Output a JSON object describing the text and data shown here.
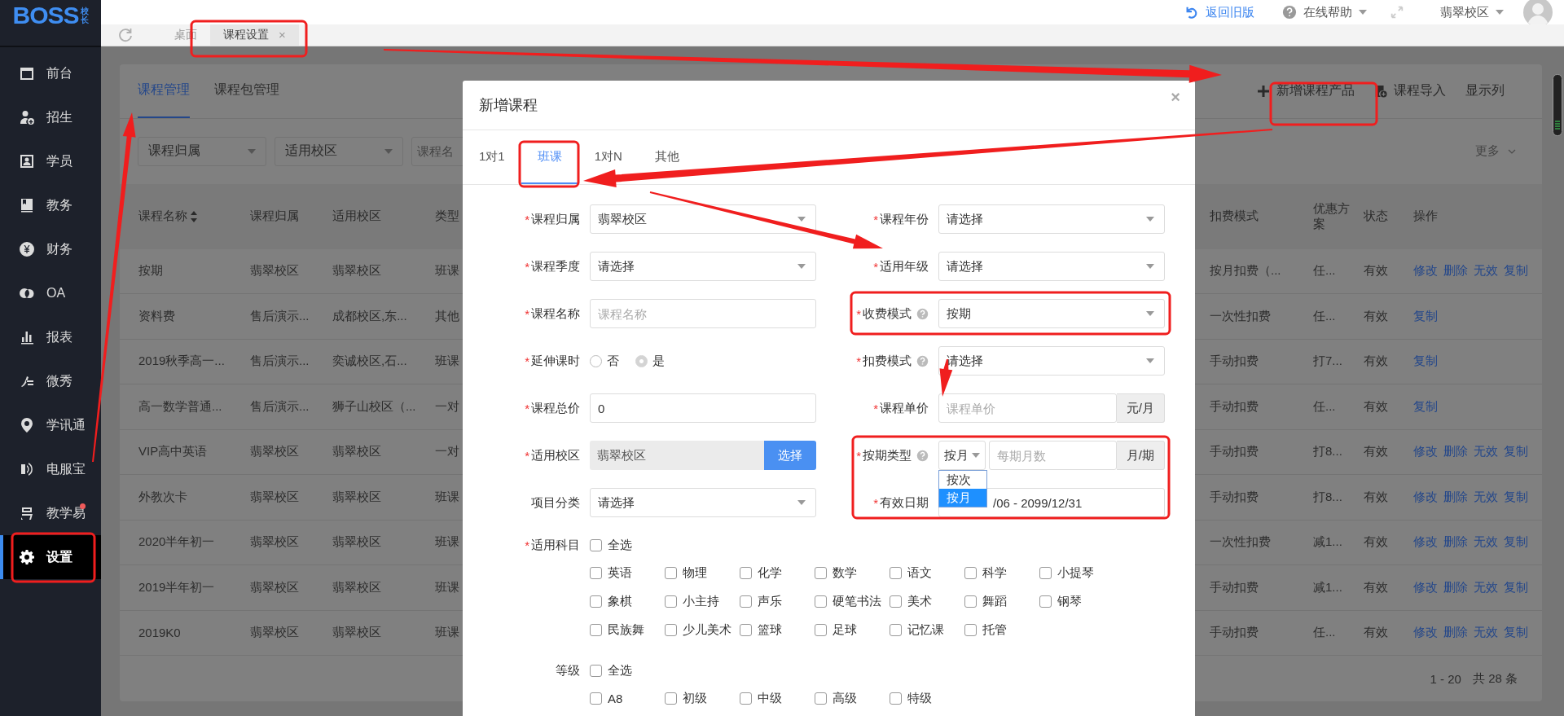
{
  "sidebar": {
    "logo": "BOSS",
    "logo_badge": "校长",
    "items": [
      {
        "label": "前台",
        "selected": false,
        "dot": false
      },
      {
        "label": "招生",
        "selected": false,
        "dot": false
      },
      {
        "label": "学员",
        "selected": false,
        "dot": false
      },
      {
        "label": "教务",
        "selected": false,
        "dot": false
      },
      {
        "label": "财务",
        "selected": false,
        "dot": false
      },
      {
        "label": "OA",
        "selected": false,
        "dot": false
      },
      {
        "label": "报表",
        "selected": false,
        "dot": false
      },
      {
        "label": "微秀",
        "selected": false,
        "dot": false
      },
      {
        "label": "学讯通",
        "selected": false,
        "dot": false
      },
      {
        "label": "电服宝",
        "selected": false,
        "dot": false
      },
      {
        "label": "教学易",
        "selected": false,
        "dot": true
      },
      {
        "label": "设置",
        "selected": true,
        "dot": false
      }
    ]
  },
  "topbar": {
    "back_link": "返回旧版",
    "help_menu": "在线帮助",
    "campus_menu": "翡翠校区"
  },
  "tabs": [
    {
      "label": "桌面",
      "selected": false
    },
    {
      "label": "课程设置",
      "selected": true,
      "close": "×"
    }
  ],
  "page": {
    "tabs": [
      {
        "label": "课程管理",
        "selected": true
      },
      {
        "label": "课程包管理",
        "selected": false
      }
    ],
    "actions": [
      "新增课程产品",
      "课程导入",
      "显示列"
    ],
    "filters": [
      {
        "kind": "select",
        "placeholder": "课程归属"
      },
      {
        "kind": "select",
        "placeholder": "适用校区"
      },
      {
        "kind": "input",
        "placeholder": "课程名"
      }
    ],
    "more": "更多"
  },
  "table": {
    "columns": [
      {
        "label": "课程名称",
        "sortable": true
      },
      {
        "label": "课程归属",
        "sortable": false
      },
      {
        "label": "适用校区",
        "sortable": false
      },
      {
        "label": "类型",
        "sortable": false
      },
      {
        "label": "扣费模式",
        "sortable": false
      },
      {
        "label": "优惠方案",
        "sortable": false
      },
      {
        "label": "状态",
        "sortable": false
      },
      {
        "label": "操作",
        "sortable": false
      }
    ],
    "rows": [
      {
        "cells": [
          "按期",
          "翡翠校区",
          "翡翠校区",
          "班课",
          "按月扣费（...",
          "任...",
          "有效"
        ],
        "actions": [
          "修改",
          "删除",
          "无效",
          "复制"
        ]
      },
      {
        "cells": [
          "资料费",
          "售后演示...",
          "成都校区,东...",
          "其他",
          "一次性扣费",
          "任...",
          "有效"
        ],
        "actions": [
          "复制"
        ]
      },
      {
        "cells": [
          "2019秋季高一...",
          "售后演示...",
          "奕诚校区,石...",
          "班课",
          "手动扣费",
          "打7...",
          "有效"
        ],
        "actions": [
          "复制"
        ]
      },
      {
        "cells": [
          "高一数学普通...",
          "售后演示...",
          "狮子山校区（...",
          "一对",
          "手动扣费",
          "任...",
          "有效"
        ],
        "actions": [
          "复制"
        ]
      },
      {
        "cells": [
          "VIP高中英语",
          "翡翠校区",
          "翡翠校区",
          "一对",
          "手动扣费",
          "打8...",
          "有效"
        ],
        "actions": [
          "修改",
          "删除",
          "无效",
          "复制"
        ]
      },
      {
        "cells": [
          "外教次卡",
          "翡翠校区",
          "翡翠校区",
          "班课",
          "手动扣费",
          "打8...",
          "有效"
        ],
        "actions": [
          "修改",
          "删除",
          "无效",
          "复制"
        ]
      },
      {
        "cells": [
          "2020半年初一",
          "翡翠校区",
          "翡翠校区",
          "班课",
          "一次性扣费",
          "减1...",
          "有效"
        ],
        "actions": [
          "修改",
          "删除",
          "无效",
          "复制"
        ]
      },
      {
        "cells": [
          "2019半年初一",
          "翡翠校区",
          "翡翠校区",
          "班课",
          "手动扣费",
          "减1...",
          "有效"
        ],
        "actions": [
          "修改",
          "删除",
          "无效",
          "复制"
        ]
      },
      {
        "cells": [
          "2019K0",
          "翡翠校区",
          "翡翠校区",
          "班课",
          "手动扣费",
          "任...",
          "有效"
        ],
        "actions": [
          "修改",
          "删除",
          "无效",
          "复制"
        ]
      }
    ],
    "pagination": {
      "range": "1 - 20",
      "total": "共 28 条"
    }
  },
  "modal": {
    "title": "新增课程",
    "close": "×",
    "tabs": [
      {
        "label": "1对1",
        "selected": false
      },
      {
        "label": "班课",
        "selected": true
      },
      {
        "label": "1对N",
        "selected": false
      },
      {
        "label": "其他",
        "selected": false
      }
    ],
    "fields": [
      {
        "label": "课程归属",
        "mark": "*",
        "kind": "select",
        "value": "翡翠校区"
      },
      {
        "label": "课程年份",
        "mark": "*",
        "kind": "select",
        "value": "请选择"
      },
      {
        "label": "课程季度",
        "mark": "*",
        "kind": "select",
        "value": "请选择"
      },
      {
        "label": "适用年级",
        "mark": "*",
        "kind": "select",
        "value": "请选择"
      },
      {
        "label": "课程名称",
        "mark": "*",
        "kind": "input",
        "placeholder": "课程名称"
      },
      {
        "label": "收费模式",
        "mark": "*",
        "help": true,
        "kind": "select",
        "value": "按期"
      },
      {
        "label": "延伸课时",
        "mark": "*",
        "kind": "radio",
        "options": [
          {
            "label": "否",
            "selected": false
          },
          {
            "label": "是",
            "selected": true
          }
        ]
      },
      {
        "label": "扣费模式",
        "mark": "*",
        "help": true,
        "kind": "select",
        "value": "请选择"
      },
      {
        "label": "课程总价",
        "mark": "*",
        "kind": "input",
        "value": "0"
      },
      {
        "label": "课程单价",
        "mark": "*",
        "kind": "addon",
        "placeholder": "课程单价",
        "unit": "元/月"
      },
      {
        "label": "适用校区",
        "mark": "*",
        "kind": "picker",
        "value": "翡翠校区",
        "button": "选择"
      },
      {
        "label": "按期类型",
        "mark": "*",
        "help": true,
        "kind": "period",
        "value": "按月",
        "placeholder": "每期月数",
        "unit": "月/期",
        "menu": [
          {
            "label": "按次",
            "selected": false
          },
          {
            "label": "按月",
            "selected": true
          }
        ]
      },
      {
        "label": "项目分类",
        "kind": "select",
        "value": "请选择"
      },
      {
        "label": "有效日期",
        "mark": "*",
        "kind": "date",
        "value": "/06 - 2099/12/31"
      }
    ],
    "groups": [
      {
        "label": "适用科目",
        "mark": "*",
        "select_all": {
          "label": "全选",
          "checked": false
        },
        "options": [
          {
            "label": "英语",
            "checked": false
          },
          {
            "label": "物理",
            "checked": false
          },
          {
            "label": "化学",
            "checked": false
          },
          {
            "label": "数学",
            "checked": false
          },
          {
            "label": "语文",
            "checked": false
          },
          {
            "label": "科学",
            "checked": false
          },
          {
            "label": "小提琴",
            "checked": false
          },
          {
            "label": "象棋",
            "checked": false
          },
          {
            "label": "小主持",
            "checked": false
          },
          {
            "label": "声乐",
            "checked": false
          },
          {
            "label": "硬笔书法",
            "checked": false
          },
          {
            "label": "美术",
            "checked": false
          },
          {
            "label": "舞蹈",
            "checked": false
          },
          {
            "label": "钢琴",
            "checked": false
          },
          {
            "label": "民族舞",
            "checked": false
          },
          {
            "label": "少儿美术",
            "checked": false
          },
          {
            "label": "篮球",
            "checked": false
          },
          {
            "label": "足球",
            "checked": false
          },
          {
            "label": "记忆课",
            "checked": false
          },
          {
            "label": "托管",
            "checked": false
          }
        ]
      },
      {
        "label": "等级",
        "select_all": {
          "label": "全选",
          "checked": false
        },
        "options": [
          {
            "label": "A8",
            "checked": false
          },
          {
            "label": "初级",
            "checked": false
          },
          {
            "label": "中级",
            "checked": false
          },
          {
            "label": "高级",
            "checked": false
          },
          {
            "label": "特级",
            "checked": false
          }
        ]
      }
    ]
  }
}
